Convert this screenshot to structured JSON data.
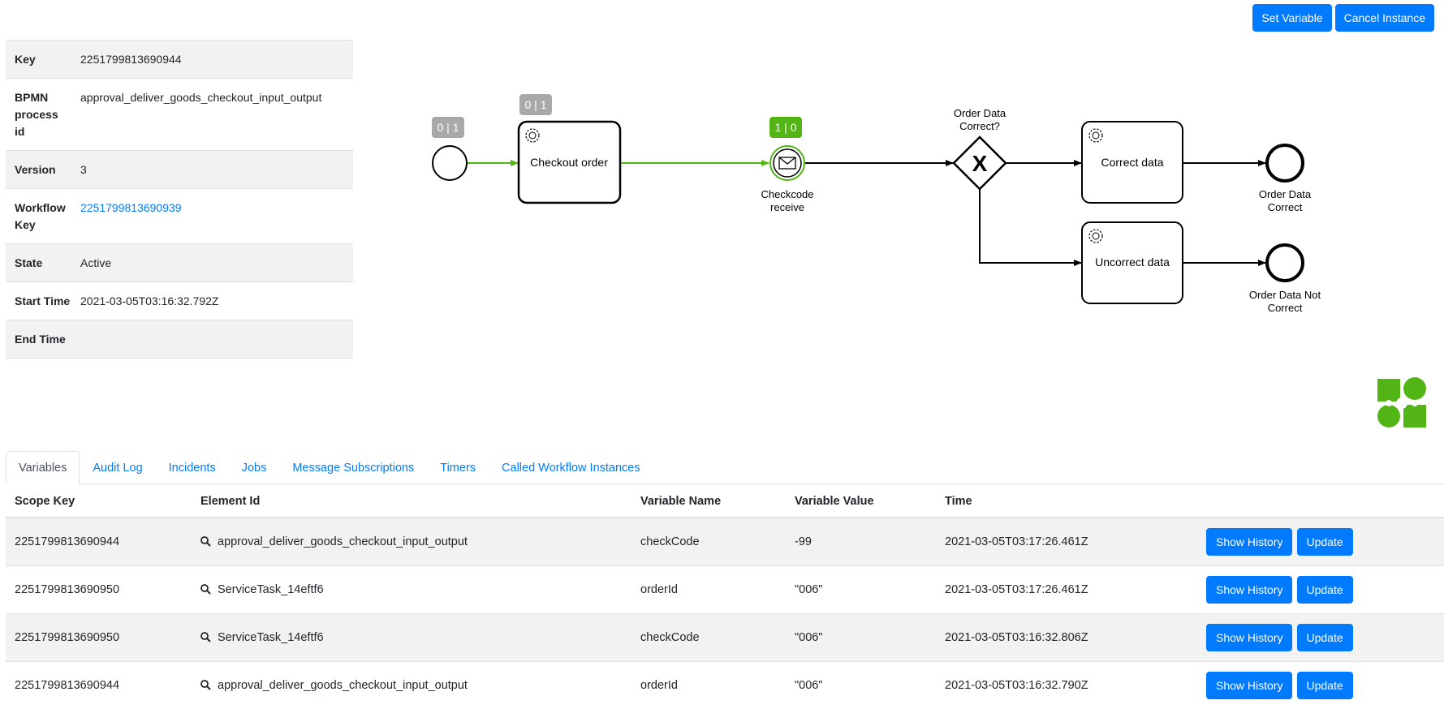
{
  "actions": {
    "set_variable": "Set Variable",
    "cancel_instance": "Cancel Instance"
  },
  "details": {
    "key_label": "Key",
    "key": "2251799813690944",
    "process_id_label": "BPMN process id",
    "process_id": "approval_deliver_goods_checkout_input_output",
    "version_label": "Version",
    "version": "3",
    "workflow_key_label": "Workflow Key",
    "workflow_key": "2251799813690939",
    "state_label": "State",
    "state": "Active",
    "start_time_label": "Start Time",
    "start_time": "2021-03-05T03:16:32.792Z",
    "end_time_label": "End Time",
    "end_time": ""
  },
  "diagram": {
    "badges": {
      "start": "0 | 1",
      "checkout": "0 | 1",
      "checkcode": "1 | 0"
    },
    "nodes": {
      "checkout": "Checkout order",
      "checkcode_line1": "Checkcode",
      "checkcode_line2": "receive",
      "gateway_line1": "Order Data",
      "gateway_line2": "Correct?",
      "correct_task": "Correct data",
      "uncorrect_task": "Uncorrect data",
      "end_correct_line1": "Order Data",
      "end_correct_line2": "Correct",
      "end_not_line1": "Order Data Not",
      "end_not_line2": "Correct"
    },
    "colors": {
      "active": "#52b415",
      "badge_gray": "#a9a9a9",
      "badge_green": "#52b415"
    }
  },
  "tabs": [
    "Variables",
    "Audit Log",
    "Incidents",
    "Jobs",
    "Message Subscriptions",
    "Timers",
    "Called Workflow Instances"
  ],
  "variables": {
    "headers": {
      "scope_key": "Scope Key",
      "element_id": "Element Id",
      "name": "Variable Name",
      "value": "Variable Value",
      "time": "Time"
    },
    "rows": [
      {
        "scope_key": "2251799813690944",
        "element_id": "approval_deliver_goods_checkout_input_output",
        "name": "checkCode",
        "value": "-99",
        "time": "2021-03-05T03:17:26.461Z"
      },
      {
        "scope_key": "2251799813690950",
        "element_id": "ServiceTask_14eftf6",
        "name": "orderId",
        "value": "\"006\"",
        "time": "2021-03-05T03:17:26.461Z"
      },
      {
        "scope_key": "2251799813690950",
        "element_id": "ServiceTask_14eftf6",
        "name": "checkCode",
        "value": "\"006\"",
        "time": "2021-03-05T03:16:32.806Z"
      },
      {
        "scope_key": "2251799813690944",
        "element_id": "approval_deliver_goods_checkout_input_output",
        "name": "orderId",
        "value": "\"006\"",
        "time": "2021-03-05T03:16:32.790Z"
      }
    ],
    "show_history": "Show History",
    "update": "Update"
  }
}
